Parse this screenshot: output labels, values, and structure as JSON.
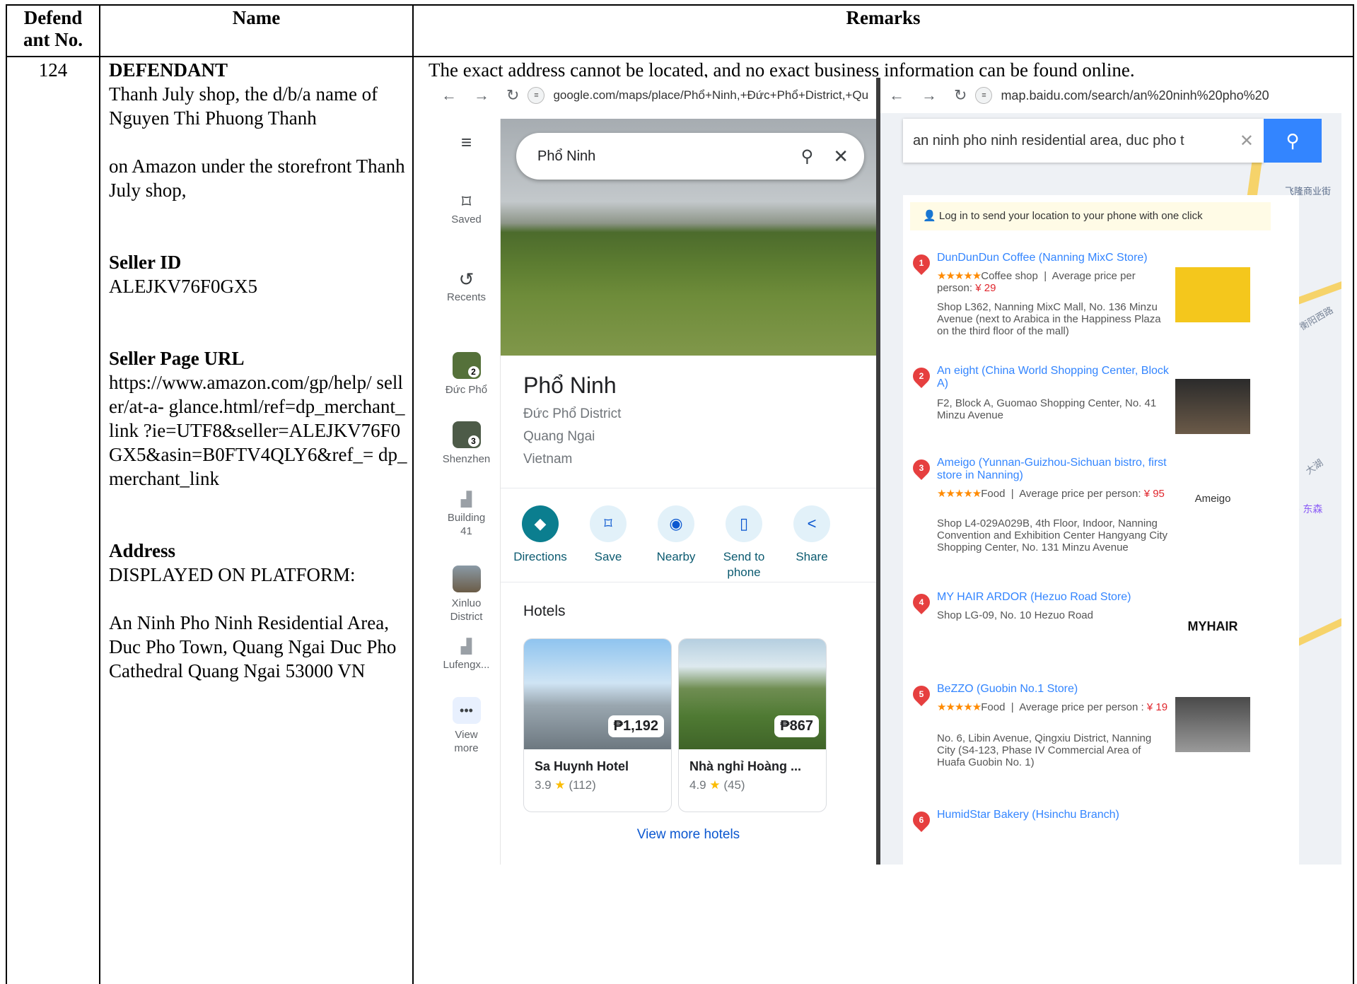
{
  "table": {
    "headers": {
      "defendant_no": "Defend ant No.",
      "name": "Name",
      "remarks": "Remarks"
    },
    "row": {
      "number": "124",
      "name_heading": "DEFENDANT",
      "name_line": "Thanh July shop, the d/b/a name of Nguyen Thi Phuong Thanh",
      "storefront": "on Amazon under the storefront Thanh July shop,",
      "seller_id_label": "Seller ID",
      "seller_id": "ALEJKV76F0GX5",
      "seller_url_label": "Seller Page URL",
      "seller_url": "https://www.amazon.com/gp/help/ seller/at-a- glance.html/ref=dp_merchant_link ?ie=UTF8&seller=ALEJKV76F0 GX5&asin=B0FTV4QLY6&ref_= dp_merchant_link",
      "address_label": "Address",
      "address_platform": "DISPLAYED ON PLATFORM:",
      "address": "An Ninh Pho Ninh Residential Area, Duc Pho Town, Quang Ngai Duc Pho Cathedral Quang Ngai 53000 VN",
      "remarks_text": "The exact address cannot be located, and no exact business information can be found online."
    }
  },
  "google_maps": {
    "url": "google.com/maps/place/Phổ+Ninh,+Đức+Phổ+District,+Qu",
    "search_value": "Phổ Ninh",
    "rail": [
      {
        "label": "Saved",
        "icon": "bookmark-icon"
      },
      {
        "label": "Recents",
        "icon": "history-icon"
      },
      {
        "label": "Đức Phổ",
        "badge": "2"
      },
      {
        "label": "Shenzhen",
        "badge": "3"
      },
      {
        "label": "Building 41",
        "icon": "building-icon"
      },
      {
        "label": "Xinluo District",
        "icon": "photo-icon"
      },
      {
        "label": "Lufengx...",
        "icon": "building-icon"
      },
      {
        "label": "View more",
        "icon": "more-icon"
      }
    ],
    "place": {
      "name": "Phổ Ninh",
      "district": "Đức Phổ District",
      "province": "Quang Ngai",
      "country": "Vietnam"
    },
    "actions": [
      "Directions",
      "Save",
      "Nearby",
      "Send to phone",
      "Share"
    ],
    "hotels_heading": "Hotels",
    "hotels": [
      {
        "name": "Sa Huynh Hotel",
        "price": "₱1,192",
        "rating": "3.9",
        "reviews": "(112)"
      },
      {
        "name": "Nhà nghỉ Hoàng ...",
        "price": "₱867",
        "rating": "4.9",
        "reviews": "(45)"
      }
    ],
    "view_more_hotels": "View more hotels"
  },
  "baidu_map": {
    "url": "map.baidu.com/search/an%20ninh%20pho%20",
    "search_value": "an ninh pho ninh residential area, duc pho t",
    "login_prompt": "Log in to send your location to your phone with one click",
    "results": [
      {
        "num": "1",
        "title": "DunDunDun Coffee (Nanning MixC Store)",
        "category": "Coffee shop",
        "price_label": "Average price per person:",
        "price": "¥ 29",
        "address": "Shop L362, Nanning MixC Mall, No. 136 Minzu Avenue (next to Arabica in the Happiness Plaza on the third floor of the mall)"
      },
      {
        "num": "2",
        "title": "An eight (China World Shopping Center, Block A)",
        "address": "F2, Block A, Guomao Shopping Center, No. 41 Minzu Avenue"
      },
      {
        "num": "3",
        "title": "Ameigo (Yunnan-Guizhou-Sichuan bistro, first store in Nanning)",
        "category": "Food",
        "price_label": "Average price per person:",
        "price": "¥ 95",
        "address": "Shop L4-029A029B, 4th Floor, Indoor, Nanning Convention and Exhibition Center Hangyang City Shopping Center, No. 131 Minzu Avenue",
        "logo_text": "Ameigo"
      },
      {
        "num": "4",
        "title": "MY HAIR ARDOR (Hezuo Road Store)",
        "address": "Shop LG-09, No. 10 Hezuo Road",
        "logo_text": "MYHAIR"
      },
      {
        "num": "5",
        "title": "BeZZO (Guobin No.1 Store)",
        "category": "Food",
        "price_label": "Average price per person :",
        "price": "¥ 19",
        "address": "No. 6, Libin Avenue, Qingxiu District, Nanning City (S4-123, Phase IV Commercial Area of Huafa Guobin No. 1)"
      },
      {
        "num": "6",
        "title": "HumidStar Bakery (Hsinchu Branch)"
      }
    ],
    "map_labels": [
      "飞隆商业街",
      "衡阳西路",
      "东森",
      "大湖"
    ]
  }
}
